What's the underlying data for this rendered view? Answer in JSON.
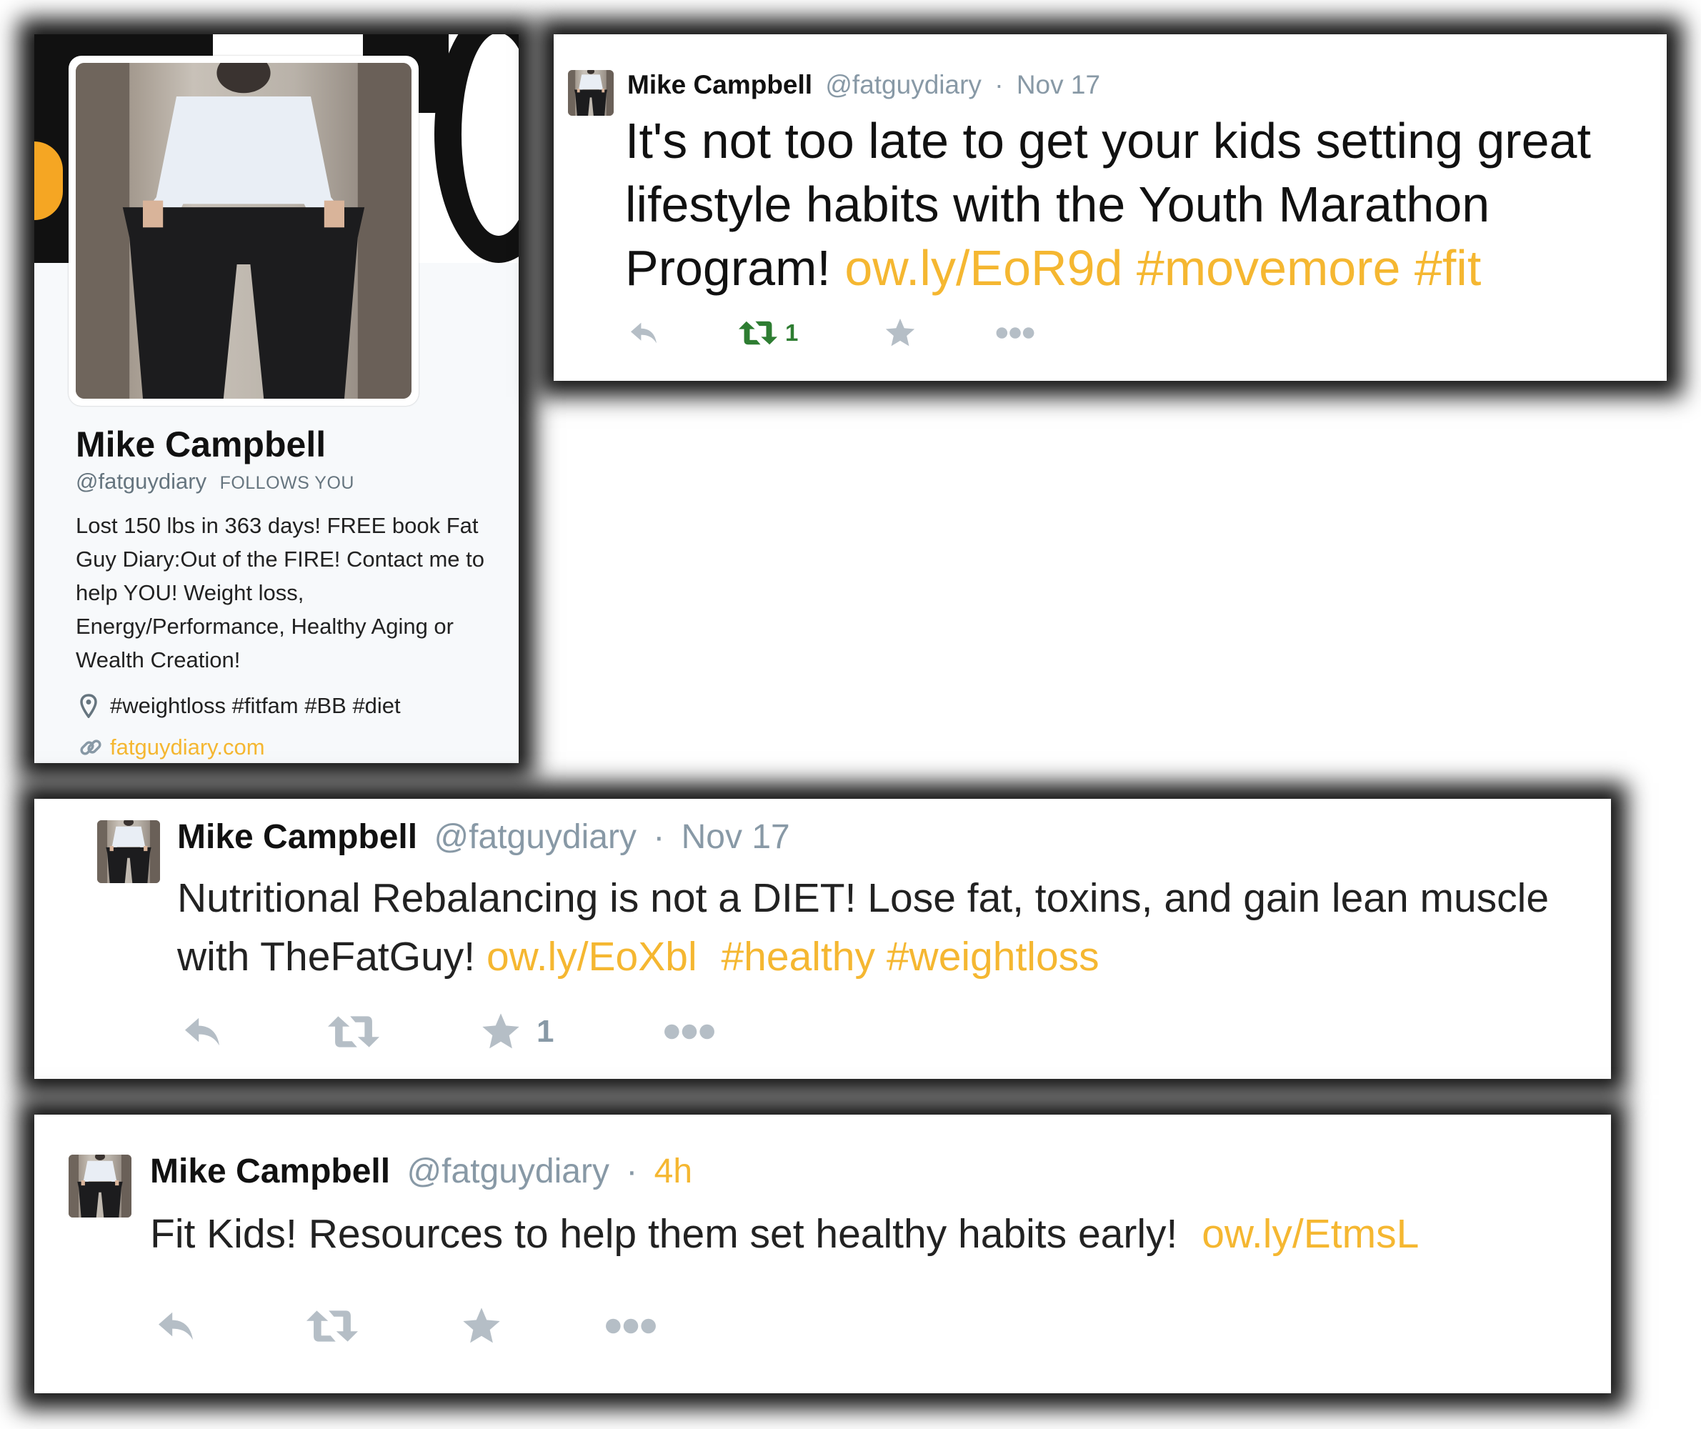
{
  "profile": {
    "name": "Mike Campbell",
    "handle": "@fatguydiary",
    "follows_you": "FOLLOWS YOU",
    "bio": "Lost 150 lbs in 363 days! FREE book Fat Guy Diary:Out of the FIRE! Contact me to help YOU! Weight loss, Energy/Performance, Healthy Aging or Wealth Creation!",
    "location": "#weightloss #fitfam #BB #diet",
    "website": "fatguydiary.com"
  },
  "tweets": [
    {
      "name": "Mike Campbell",
      "handle": "@fatguydiary",
      "separator": "·",
      "date": "Nov 17",
      "text": "It's not too late to get your kids setting great lifestyle habits with the Youth Marathon Program!",
      "link": "ow.ly/EoR9d",
      "hashtags": "#movemore #fit",
      "retweets": "1"
    },
    {
      "name": "Mike Campbell",
      "handle": "@fatguydiary",
      "separator": "·",
      "date": "Nov 17",
      "text": "Nutritional Rebalancing is not a DIET! Lose fat, toxins, and gain lean muscle with TheFatGuy!",
      "link": "ow.ly/EoXbl",
      "hashtags": "#healthy #weightloss",
      "favorites": "1"
    },
    {
      "name": "Mike Campbell",
      "handle": "@fatguydiary",
      "separator": "·",
      "date": "4h",
      "text": "Fit Kids! Resources to help them set healthy habits early!",
      "link": "ow.ly/EtmsL"
    }
  ],
  "colors": {
    "link": "#f5b731",
    "retweet_active": "#2e7d32",
    "muted": "#8899a6",
    "action_icon": "#b5bec6"
  },
  "icons": [
    "reply-icon",
    "retweet-icon",
    "favorite-icon",
    "more-icon",
    "location-pin-icon",
    "link-icon"
  ]
}
